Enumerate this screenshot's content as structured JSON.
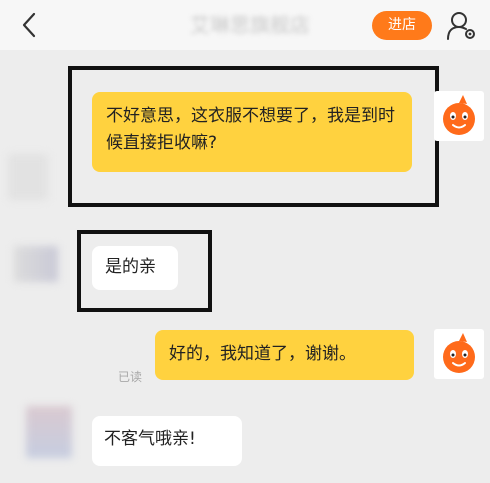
{
  "header": {
    "title": "艾琳思旗舰店",
    "store_button": "进店"
  },
  "messages": [
    {
      "direction": "out",
      "text": "不好意思，这衣服不想要了，我是到时候直接拒收嘛?"
    },
    {
      "direction": "in",
      "text": "是的亲"
    },
    {
      "direction": "out",
      "text": "好的，我知道了，谢谢。",
      "status": "已读"
    },
    {
      "direction": "in",
      "text": "不客气哦亲!"
    }
  ],
  "colors": {
    "outgoing_bubble": "#ffd23f",
    "incoming_bubble": "#ffffff",
    "store_button": "#ff7a1a",
    "background": "#ededed"
  }
}
